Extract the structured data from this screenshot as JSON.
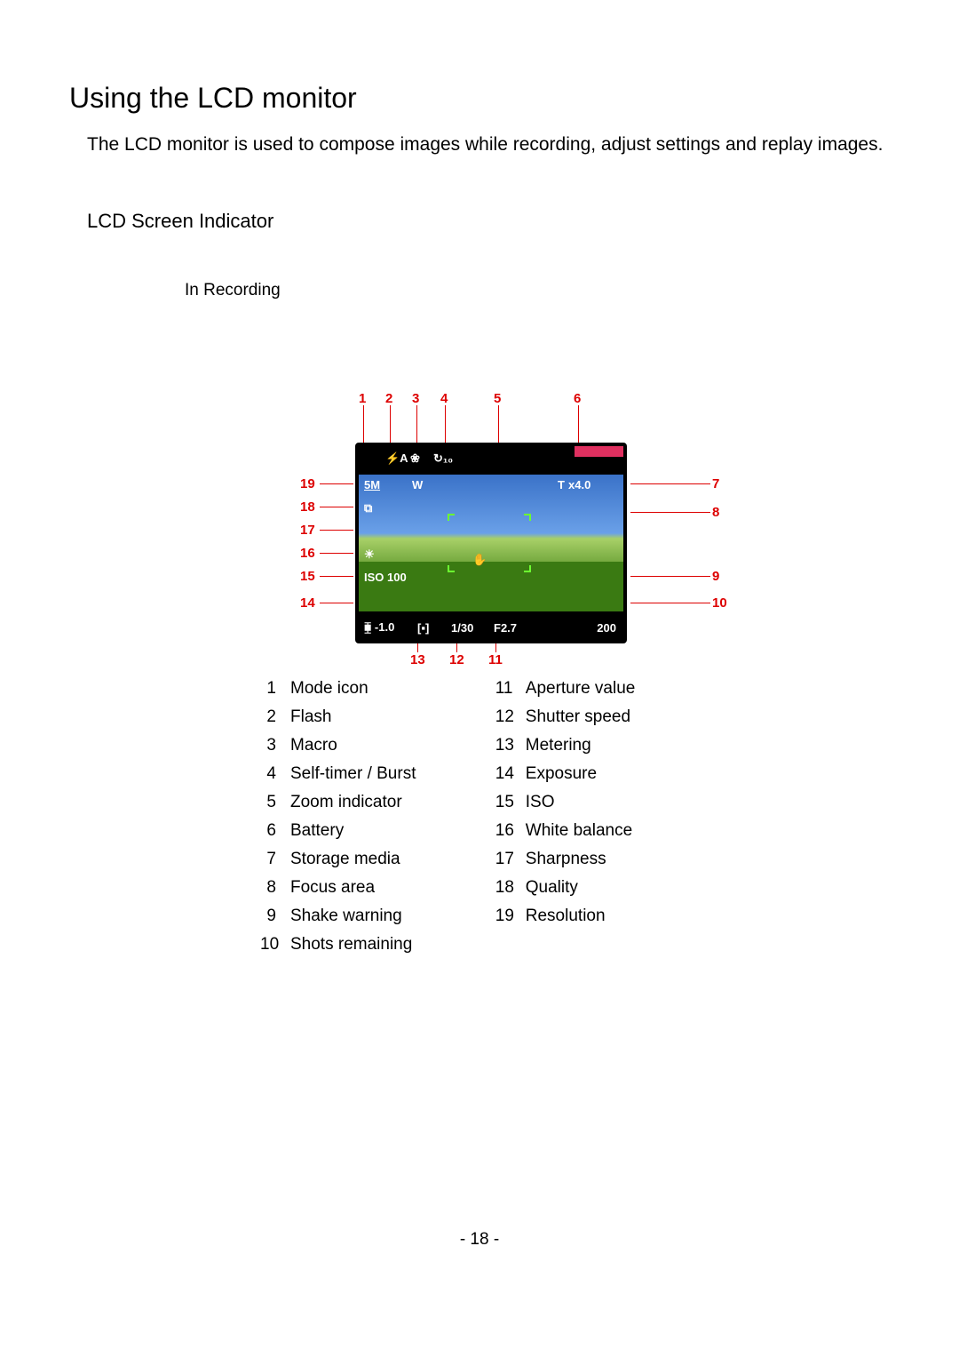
{
  "title": "Using the LCD monitor",
  "body": "The LCD monitor is used to compose images while recording, adjust settings and replay images.",
  "subtitle": "LCD Screen Indicator",
  "modeLabel": "In Recording",
  "page_number": "- 18 -",
  "lcd": {
    "flash": "⚡A",
    "macro": "❀",
    "timer": "↻₁₀",
    "resolution": "5M",
    "zoom_w": "W",
    "zoom_t": "T",
    "zoom_value": "x4.0",
    "quality": "⧉",
    "wb": "☀",
    "iso": "ISO\n100",
    "shake": "✋",
    "exposure": "⧯ -1.0",
    "metering": "[▪]",
    "shutter": "1/30",
    "aperture": "F2.7",
    "shots": "200"
  },
  "callouts": {
    "c1": "1",
    "c2": "2",
    "c3": "3",
    "c4": "4",
    "c5": "5",
    "c6": "6",
    "c7": "7",
    "c8": "8",
    "c9": "9",
    "c10": "10",
    "c11": "11",
    "c12": "12",
    "c13": "13",
    "c14": "14",
    "c15": "15",
    "c16": "16",
    "c17": "17",
    "c18": "18",
    "c19": "19"
  },
  "legend_left": [
    {
      "n": "1",
      "t": "Mode icon"
    },
    {
      "n": "2",
      "t": "Flash"
    },
    {
      "n": "3",
      "t": "Macro"
    },
    {
      "n": "4",
      "t": "Self-timer / Burst"
    },
    {
      "n": "5",
      "t": "Zoom indicator"
    },
    {
      "n": "6",
      "t": "Battery"
    },
    {
      "n": "7",
      "t": "Storage media"
    },
    {
      "n": "8",
      "t": "Focus area"
    },
    {
      "n": "9",
      "t": "Shake warning"
    },
    {
      "n": "10",
      "t": "Shots remaining"
    }
  ],
  "legend_right": [
    {
      "n": "11",
      "t": "Aperture value"
    },
    {
      "n": "12",
      "t": "Shutter speed"
    },
    {
      "n": "13",
      "t": "Metering"
    },
    {
      "n": "14",
      "t": "Exposure"
    },
    {
      "n": "15",
      "t": "ISO"
    },
    {
      "n": "16",
      "t": "White balance"
    },
    {
      "n": "17",
      "t": "Sharpness"
    },
    {
      "n": "18",
      "t": "Quality"
    },
    {
      "n": "19",
      "t": "Resolution"
    }
  ]
}
